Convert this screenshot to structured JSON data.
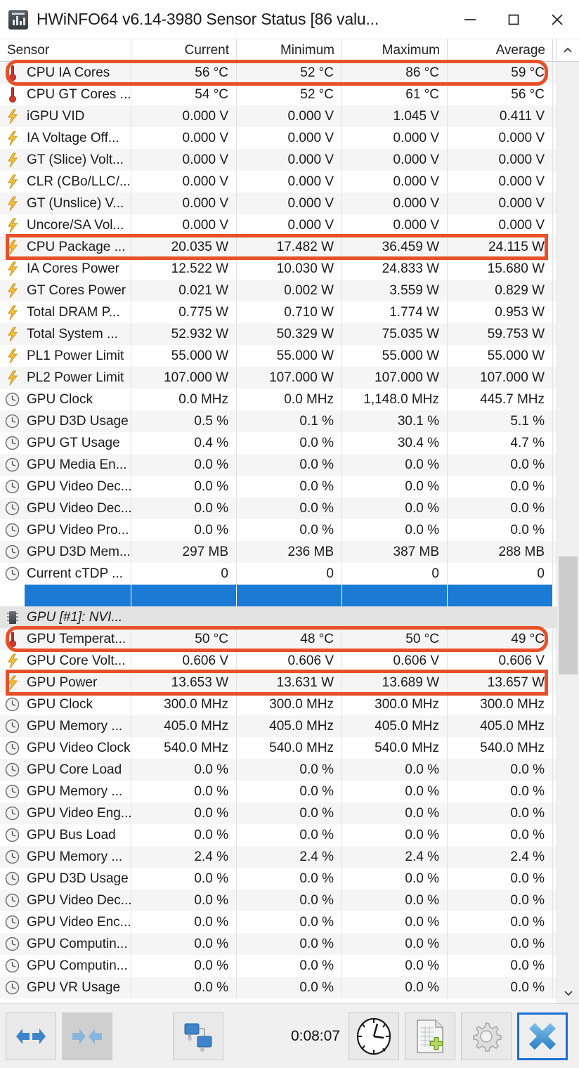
{
  "window": {
    "title": "HWiNFO64 v6.14-3980 Sensor Status [86 valu...",
    "app_icon": "bar-chart-app-icon",
    "minimize_label": "Minimize",
    "maximize_label": "Maximize",
    "close_label": "Close"
  },
  "columns": [
    "Sensor",
    "Current",
    "Minimum",
    "Maximum",
    "Average"
  ],
  "accent": {
    "highlight_box": "#e8502a",
    "selection_blue": "#1a7ad4",
    "temp_red": "#c1392b",
    "bolt_yellow": "#f2b01e"
  },
  "rows": [
    {
      "icon": "thermometer-icon",
      "name": "CPU IA Cores",
      "current": "56 °C",
      "minimum": "52 °C",
      "maximum": "86 °C",
      "average": "59 °C"
    },
    {
      "icon": "thermometer-icon",
      "name": "CPU GT Cores ...",
      "current": "54 °C",
      "minimum": "52 °C",
      "maximum": "61 °C",
      "average": "56 °C"
    },
    {
      "icon": "lightning-bolt-icon",
      "name": "iGPU VID",
      "current": "0.000 V",
      "minimum": "0.000 V",
      "maximum": "1.045 V",
      "average": "0.411 V"
    },
    {
      "icon": "lightning-bolt-icon",
      "name": "IA Voltage Off...",
      "current": "0.000 V",
      "minimum": "0.000 V",
      "maximum": "0.000 V",
      "average": "0.000 V"
    },
    {
      "icon": "lightning-bolt-icon",
      "name": "GT (Slice) Volt...",
      "current": "0.000 V",
      "minimum": "0.000 V",
      "maximum": "0.000 V",
      "average": "0.000 V"
    },
    {
      "icon": "lightning-bolt-icon",
      "name": "CLR (CBo/LLC/...",
      "current": "0.000 V",
      "minimum": "0.000 V",
      "maximum": "0.000 V",
      "average": "0.000 V"
    },
    {
      "icon": "lightning-bolt-icon",
      "name": "GT (Unslice) V...",
      "current": "0.000 V",
      "minimum": "0.000 V",
      "maximum": "0.000 V",
      "average": "0.000 V"
    },
    {
      "icon": "lightning-bolt-icon",
      "name": "Uncore/SA Vol...",
      "current": "0.000 V",
      "minimum": "0.000 V",
      "maximum": "0.000 V",
      "average": "0.000 V"
    },
    {
      "icon": "lightning-bolt-icon",
      "name": "CPU Package ...",
      "current": "20.035 W",
      "minimum": "17.482 W",
      "maximum": "36.459 W",
      "average": "24.115 W"
    },
    {
      "icon": "lightning-bolt-icon",
      "name": "IA Cores Power",
      "current": "12.522 W",
      "minimum": "10.030 W",
      "maximum": "24.833 W",
      "average": "15.680 W"
    },
    {
      "icon": "lightning-bolt-icon",
      "name": "GT Cores Power",
      "current": "0.021 W",
      "minimum": "0.002 W",
      "maximum": "3.559 W",
      "average": "0.829 W"
    },
    {
      "icon": "lightning-bolt-icon",
      "name": "Total DRAM P...",
      "current": "0.775 W",
      "minimum": "0.710 W",
      "maximum": "1.774 W",
      "average": "0.953 W"
    },
    {
      "icon": "lightning-bolt-icon",
      "name": "Total System ...",
      "current": "52.932 W",
      "minimum": "50.329 W",
      "maximum": "75.035 W",
      "average": "59.753 W"
    },
    {
      "icon": "lightning-bolt-icon",
      "name": "PL1 Power Limit",
      "current": "55.000 W",
      "minimum": "55.000 W",
      "maximum": "55.000 W",
      "average": "55.000 W"
    },
    {
      "icon": "lightning-bolt-icon",
      "name": "PL2 Power Limit",
      "current": "107.000 W",
      "minimum": "107.000 W",
      "maximum": "107.000 W",
      "average": "107.000 W"
    },
    {
      "icon": "clock-icon",
      "name": "GPU Clock",
      "current": "0.0 MHz",
      "minimum": "0.0 MHz",
      "maximum": "1,148.0 MHz",
      "average": "445.7 MHz"
    },
    {
      "icon": "clock-icon",
      "name": "GPU D3D Usage",
      "current": "0.5 %",
      "minimum": "0.1 %",
      "maximum": "30.1 %",
      "average": "5.1 %"
    },
    {
      "icon": "clock-icon",
      "name": "GPU GT Usage",
      "current": "0.4 %",
      "minimum": "0.0 %",
      "maximum": "30.4 %",
      "average": "4.7 %"
    },
    {
      "icon": "clock-icon",
      "name": "GPU Media En...",
      "current": "0.0 %",
      "minimum": "0.0 %",
      "maximum": "0.0 %",
      "average": "0.0 %"
    },
    {
      "icon": "clock-icon",
      "name": "GPU Video Dec...",
      "current": "0.0 %",
      "minimum": "0.0 %",
      "maximum": "0.0 %",
      "average": "0.0 %"
    },
    {
      "icon": "clock-icon",
      "name": "GPU Video Dec...",
      "current": "0.0 %",
      "minimum": "0.0 %",
      "maximum": "0.0 %",
      "average": "0.0 %"
    },
    {
      "icon": "clock-icon",
      "name": "GPU Video Pro...",
      "current": "0.0 %",
      "minimum": "0.0 %",
      "maximum": "0.0 %",
      "average": "0.0 %"
    },
    {
      "icon": "clock-icon",
      "name": "GPU D3D Mem...",
      "current": "297 MB",
      "minimum": "236 MB",
      "maximum": "387 MB",
      "average": "288 MB"
    },
    {
      "icon": "clock-icon",
      "name": "Current cTDP ...",
      "current": "0",
      "minimum": "0",
      "maximum": "0",
      "average": "0"
    },
    {
      "icon": "",
      "name": "",
      "current": "",
      "minimum": "",
      "maximum": "",
      "average": "",
      "selected": true
    },
    {
      "icon": "chip-icon",
      "name": "GPU [#1]: NVI...",
      "current": "",
      "minimum": "",
      "maximum": "",
      "average": "",
      "group": true
    },
    {
      "icon": "thermometer-icon",
      "name": "GPU Temperat...",
      "current": "50 °C",
      "minimum": "48 °C",
      "maximum": "50 °C",
      "average": "49 °C"
    },
    {
      "icon": "lightning-bolt-icon",
      "name": "GPU Core Volt...",
      "current": "0.606 V",
      "minimum": "0.606 V",
      "maximum": "0.606 V",
      "average": "0.606 V"
    },
    {
      "icon": "lightning-bolt-icon",
      "name": "GPU Power",
      "current": "13.653 W",
      "minimum": "13.631 W",
      "maximum": "13.689 W",
      "average": "13.657 W"
    },
    {
      "icon": "clock-icon",
      "name": "GPU Clock",
      "current": "300.0 MHz",
      "minimum": "300.0 MHz",
      "maximum": "300.0 MHz",
      "average": "300.0 MHz"
    },
    {
      "icon": "clock-icon",
      "name": "GPU Memory ...",
      "current": "405.0 MHz",
      "minimum": "405.0 MHz",
      "maximum": "405.0 MHz",
      "average": "405.0 MHz"
    },
    {
      "icon": "clock-icon",
      "name": "GPU Video Clock",
      "current": "540.0 MHz",
      "minimum": "540.0 MHz",
      "maximum": "540.0 MHz",
      "average": "540.0 MHz"
    },
    {
      "icon": "clock-icon",
      "name": "GPU Core Load",
      "current": "0.0 %",
      "minimum": "0.0 %",
      "maximum": "0.0 %",
      "average": "0.0 %"
    },
    {
      "icon": "clock-icon",
      "name": "GPU Memory ...",
      "current": "0.0 %",
      "minimum": "0.0 %",
      "maximum": "0.0 %",
      "average": "0.0 %"
    },
    {
      "icon": "clock-icon",
      "name": "GPU Video Eng...",
      "current": "0.0 %",
      "minimum": "0.0 %",
      "maximum": "0.0 %",
      "average": "0.0 %"
    },
    {
      "icon": "clock-icon",
      "name": "GPU Bus Load",
      "current": "0.0 %",
      "minimum": "0.0 %",
      "maximum": "0.0 %",
      "average": "0.0 %"
    },
    {
      "icon": "clock-icon",
      "name": "GPU Memory ...",
      "current": "2.4 %",
      "minimum": "2.4 %",
      "maximum": "2.4 %",
      "average": "2.4 %"
    },
    {
      "icon": "clock-icon",
      "name": "GPU D3D Usage",
      "current": "0.0 %",
      "minimum": "0.0 %",
      "maximum": "0.0 %",
      "average": "0.0 %"
    },
    {
      "icon": "clock-icon",
      "name": "GPU Video Dec...",
      "current": "0.0 %",
      "minimum": "0.0 %",
      "maximum": "0.0 %",
      "average": "0.0 %"
    },
    {
      "icon": "clock-icon",
      "name": "GPU Video Enc...",
      "current": "0.0 %",
      "minimum": "0.0 %",
      "maximum": "0.0 %",
      "average": "0.0 %"
    },
    {
      "icon": "clock-icon",
      "name": "GPU Computin...",
      "current": "0.0 %",
      "minimum": "0.0 %",
      "maximum": "0.0 %",
      "average": "0.0 %"
    },
    {
      "icon": "clock-icon",
      "name": "GPU Computin...",
      "current": "0.0 %",
      "minimum": "0.0 %",
      "maximum": "0.0 %",
      "average": "0.0 %"
    },
    {
      "icon": "clock-icon",
      "name": "GPU VR Usage",
      "current": "0.0 %",
      "minimum": "0.0 %",
      "maximum": "0.0 %",
      "average": "0.0 %"
    }
  ],
  "highlights": [
    {
      "label": "cpu-ia-cores-highlight",
      "row_index": 0,
      "rounded": true
    },
    {
      "label": "cpu-package-power-highlight",
      "row_index": 8,
      "rounded": false
    },
    {
      "label": "gpu-temperature-highlight",
      "row_index": 26,
      "rounded": true
    },
    {
      "label": "gpu-power-highlight",
      "row_index": 28,
      "rounded": false
    }
  ],
  "scrollbar": {
    "up_arrow": "chevron-up-icon",
    "down_arrow": "chevron-down-icon"
  },
  "toolbar": {
    "expand_all_label": "Expand All",
    "collapse_all_label": "Collapse All",
    "dual_monitor_label": "Sensor Panel",
    "timer": "0:08:07",
    "clock_label": "Reset Timer",
    "logging_label": "Start Logging",
    "settings_label": "Configure Sensors",
    "close_label": "Close"
  }
}
